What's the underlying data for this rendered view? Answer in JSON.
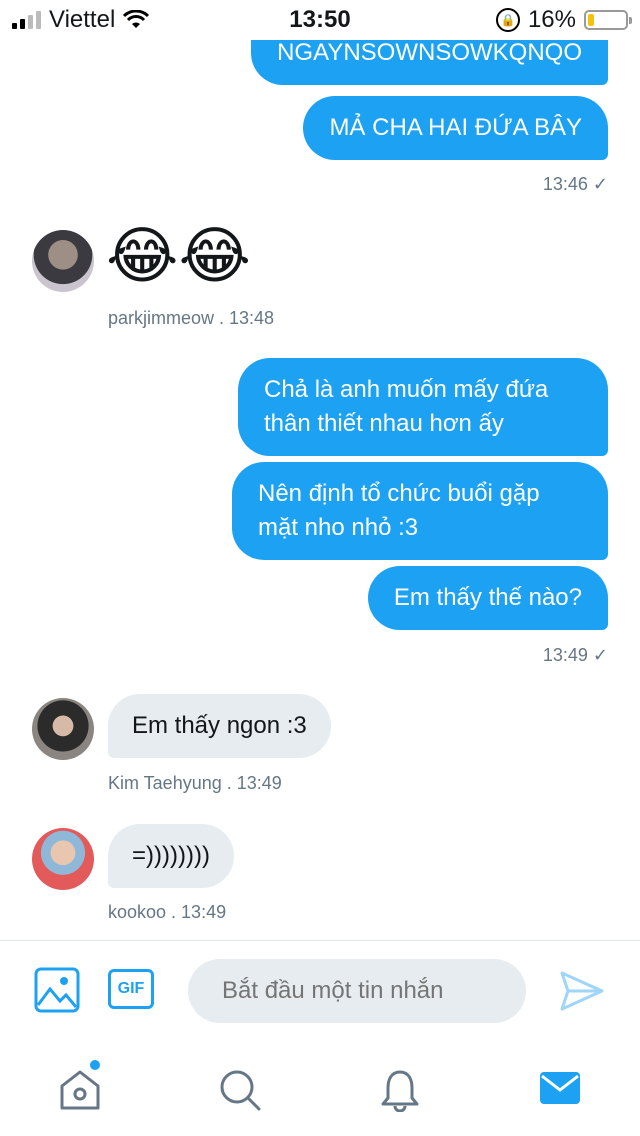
{
  "status": {
    "carrier": "Viettel",
    "time": "13:50",
    "battery_percent_text": "16%",
    "battery_level": 0.16
  },
  "messages": {
    "out1": {
      "text": "NGAYNSOWNSOWKQNQO"
    },
    "out2": {
      "text": "MẢ CHA HAI ĐỨA BÂY"
    },
    "out2_time": "13:46 ✓",
    "in1": {
      "emoji": "😂😂",
      "sender_meta": "parkjimmeow  . 13:48"
    },
    "out3": {
      "text": "Chả là anh muốn mấy đứa thân thiết nhau hơn ấy"
    },
    "out4": {
      "text": "Nên định tổ chức buổi gặp mặt nho nhỏ :3"
    },
    "out5": {
      "text": "Em thấy thế nào?"
    },
    "out5_time": "13:49 ✓",
    "in2": {
      "text": "Em thấy ngon :3",
      "sender_meta": "Kim Taehyung  . 13:49"
    },
    "in3": {
      "text": "=))))))))",
      "sender_meta": "kookoo  . 13:49"
    }
  },
  "composer": {
    "placeholder": "Bắt đầu một tin nhắn",
    "gif_label": "GIF"
  },
  "colors": {
    "accent": "#1da1f2",
    "incoming_bubble": "#e6ecf0",
    "meta_text": "#657786"
  },
  "icons": [
    "signal-icon",
    "wifi-icon",
    "rotation-lock-icon",
    "battery-icon",
    "image-icon",
    "gif-icon",
    "send-icon",
    "home-icon",
    "search-icon",
    "notifications-icon",
    "messages-icon"
  ]
}
